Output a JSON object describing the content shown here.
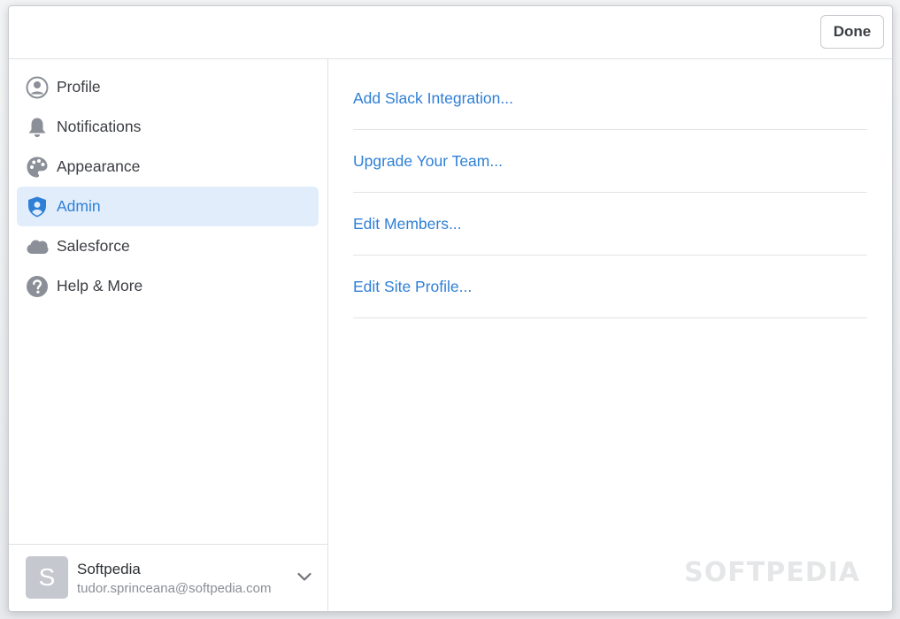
{
  "header": {
    "done_label": "Done"
  },
  "sidebar": {
    "items": [
      {
        "label": "Profile",
        "icon": "person-circle-icon",
        "active": false
      },
      {
        "label": "Notifications",
        "icon": "bell-icon",
        "active": false
      },
      {
        "label": "Appearance",
        "icon": "palette-icon",
        "active": false
      },
      {
        "label": "Admin",
        "icon": "shield-user-icon",
        "active": true
      },
      {
        "label": "Salesforce",
        "icon": "cloud-icon",
        "active": false
      },
      {
        "label": "Help & More",
        "icon": "question-circle-icon",
        "active": false
      }
    ]
  },
  "account": {
    "avatar_letter": "S",
    "name": "Softpedia",
    "email": "tudor.sprinceana@softpedia.com"
  },
  "content": {
    "links": [
      "Add Slack Integration...",
      "Upgrade Your Team...",
      "Edit Members...",
      "Edit Site Profile..."
    ]
  },
  "watermark": "SOFTPEDIA",
  "colors": {
    "accent": "#2f7fd6",
    "active_bg": "#e1edfb",
    "icon_gray": "#8b8f97"
  }
}
